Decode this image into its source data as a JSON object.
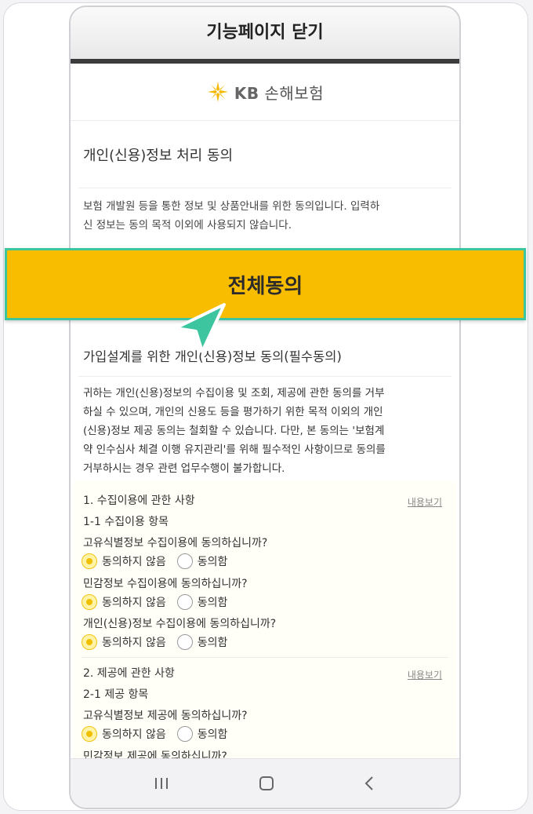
{
  "header": {
    "title": "기능페이지 닫기"
  },
  "logo": {
    "brand": "KB",
    "name": "손해보험"
  },
  "section": {
    "title": "개인(신용)정보 처리 동의",
    "intro_line1": "보험 개발원 등을 통한 정보 및 상품안내를 위한 동의입니다. 입력하",
    "intro_line2": "신 정보는 동의 목적 이외에 사용되지 않습니다."
  },
  "agree_all": {
    "label": "전체동의"
  },
  "subsection": {
    "title": "가입설계를 위한 개인(신용)정보 동의(필수동의)",
    "notice_lines": [
      "귀하는 개인(신용)정보의 수집이용 및 조회, 제공에 관한 동의를 거부",
      "하실 수 있으며, 개인의 신용도 등을 평가하기 위한 목적 이외의 개인",
      "(신용)정보 제공 동의는 철회할 수 있습니다. 다만, 본 동의는 '보험계",
      "약 인수심사 체결 이행 유지관리'를 위해 필수적인 사항이므로 동의를",
      "거부하시는 경우 관련 업무수행이 불가합니다."
    ]
  },
  "group1": {
    "heading": "1. 수집이용에 관한 사항",
    "more_label": "내용보기",
    "sub_heading": "1-1 수집이용 항목",
    "questions": [
      {
        "text": "고유식별정보 수집이용에 동의하십니까?",
        "opt_disagree": "동의하지 않음",
        "opt_agree": "동의함",
        "selected": "disagree"
      },
      {
        "text": "민감정보 수집이용에 동의하십니까?",
        "opt_disagree": "동의하지 않음",
        "opt_agree": "동의함",
        "selected": "disagree"
      },
      {
        "text": "개인(신용)정보 수집이용에 동의하십니까?",
        "opt_disagree": "동의하지 않음",
        "opt_agree": "동의함",
        "selected": "disagree"
      }
    ]
  },
  "group2": {
    "heading": "2. 제공에 관한 사항",
    "more_label": "내용보기",
    "sub_heading": "2-1 제공 항목",
    "questions": [
      {
        "text": "고유식별정보 제공에 동의하십니까?",
        "opt_disagree": "동의하지 않음",
        "opt_agree": "동의함",
        "selected": "disagree"
      },
      {
        "text": "민감정보 제공에 동의하십니까?"
      }
    ]
  },
  "navbar": {
    "icons": [
      "recent-apps-icon",
      "home-icon",
      "back-icon"
    ]
  },
  "colors": {
    "accent": "#f9bd00",
    "highlight_border": "#3cc59e",
    "cursor": "#3cc59e"
  }
}
